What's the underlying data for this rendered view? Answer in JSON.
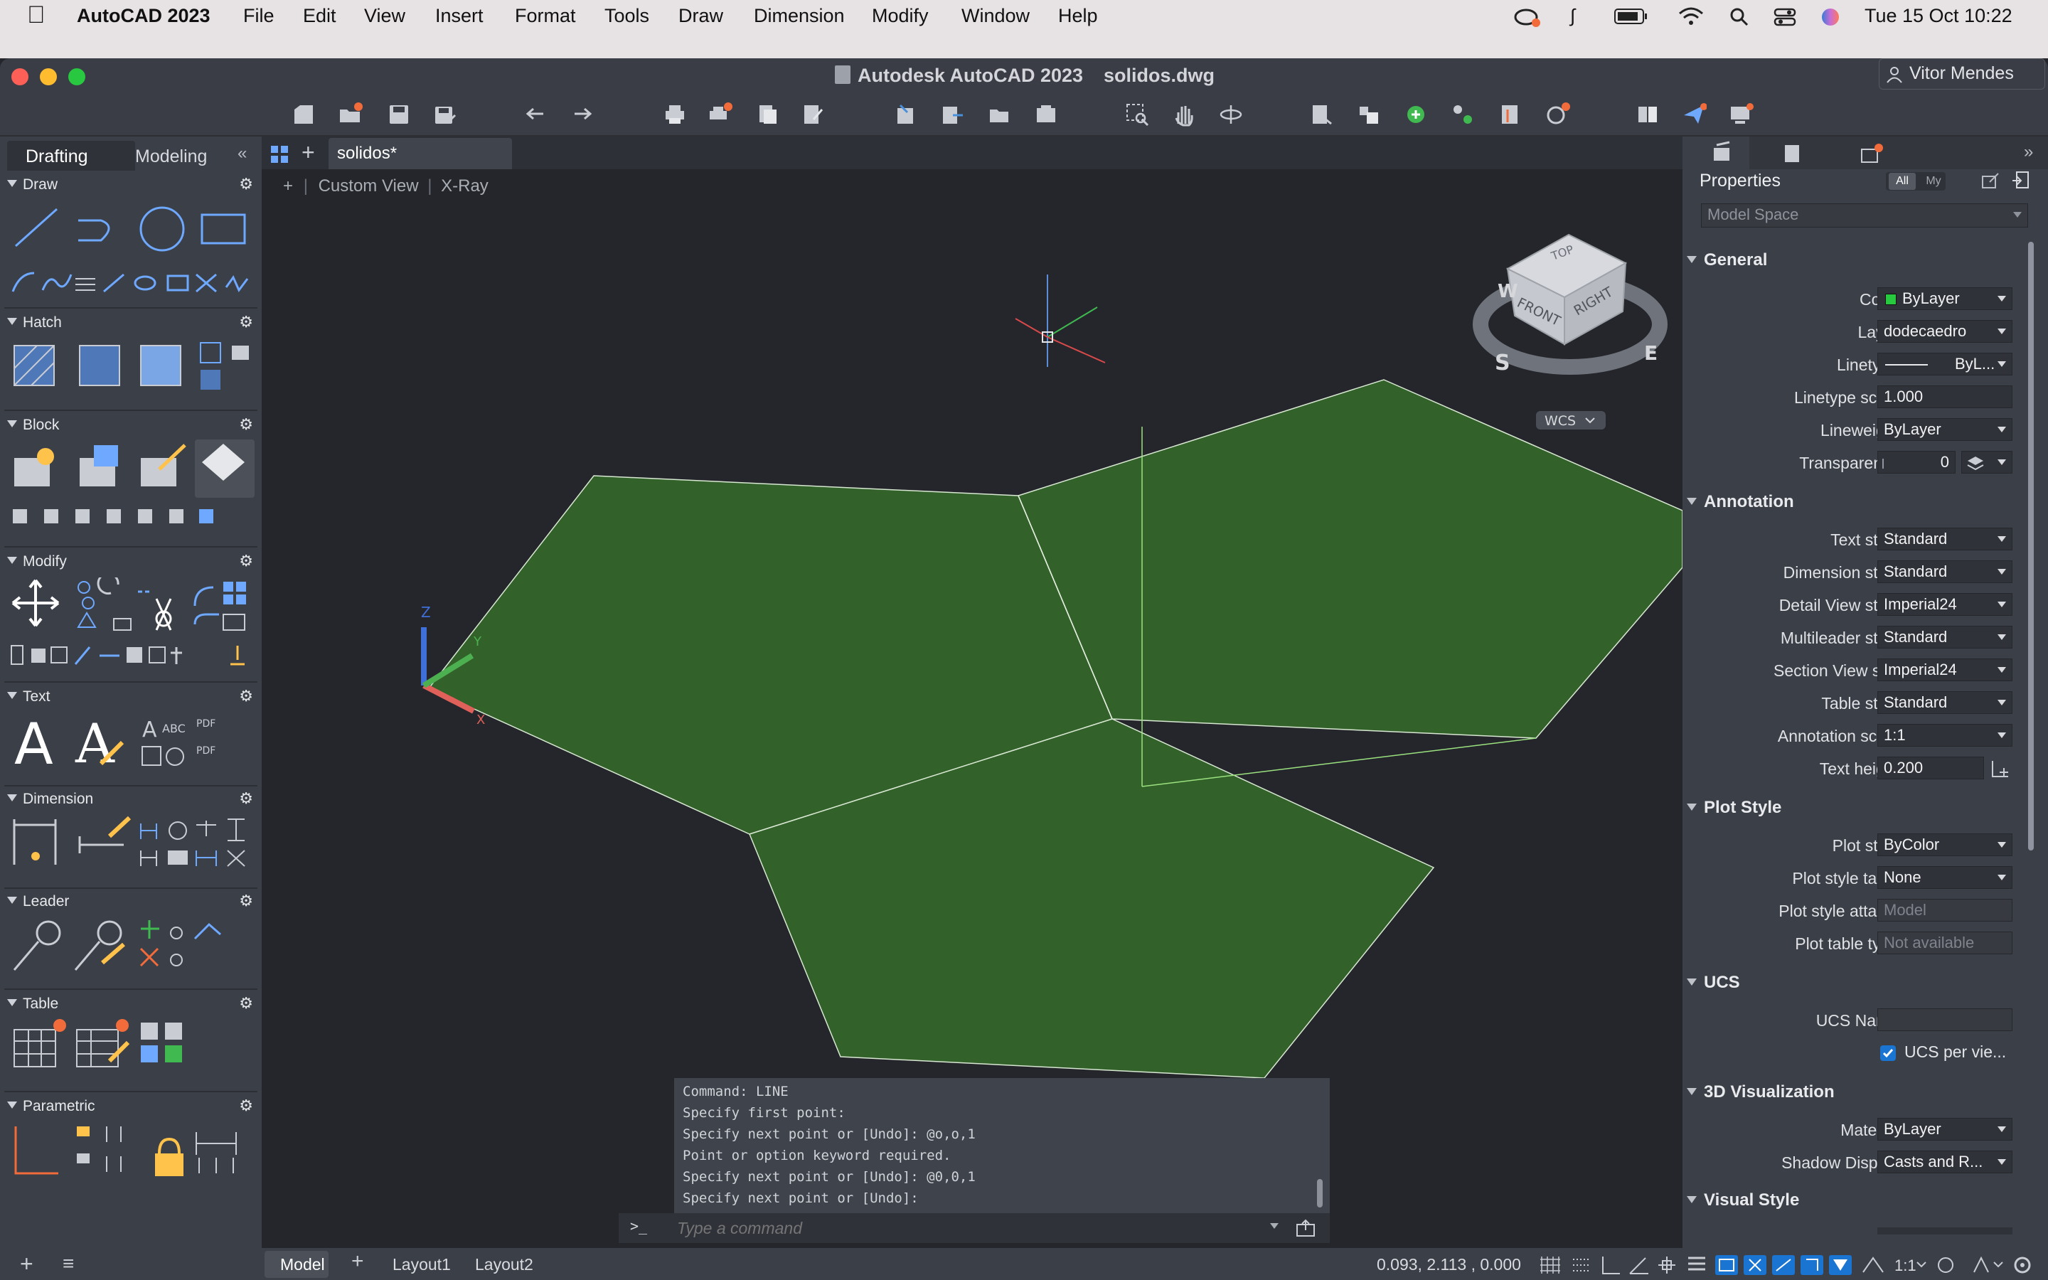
{
  "menubar": {
    "app_name": "AutoCAD 2023",
    "items": [
      "File",
      "Edit",
      "View",
      "Insert",
      "Format",
      "Tools",
      "Draw",
      "Dimension",
      "Modify",
      "Window",
      "Help"
    ],
    "datetime": "Tue 15 Oct  10:22"
  },
  "window": {
    "title_app": "Autodesk AutoCAD 2023",
    "title_file": "solidos.dwg",
    "user": "Vitor Mendes"
  },
  "palette": {
    "tabs": [
      "Drafting",
      "Modeling"
    ],
    "active_tab": "Drafting",
    "sections": [
      {
        "name": "Draw"
      },
      {
        "name": "Hatch"
      },
      {
        "name": "Block"
      },
      {
        "name": "Modify"
      },
      {
        "name": "Text"
      },
      {
        "name": "Dimension"
      },
      {
        "name": "Leader"
      },
      {
        "name": "Table"
      },
      {
        "name": "Parametric"
      }
    ]
  },
  "document": {
    "tab_label": "solidos*",
    "viewport_controls": [
      "+",
      "Custom View",
      "X-Ray"
    ]
  },
  "viewcube": {
    "faces": [
      "TOP",
      "FRONT",
      "RIGHT"
    ],
    "compass": [
      "W",
      "S",
      "E"
    ],
    "ucs_label": "WCS"
  },
  "axes": {
    "z": "Z",
    "y": "Y",
    "x": "X"
  },
  "command": {
    "history": [
      "Command: LINE",
      "Specify first point:",
      "Specify next point or [Undo]: @o,o,1",
      "Point or option keyword required.",
      "Specify next point or [Undo]: @0,0,1",
      "Specify next point or [Undo]:"
    ],
    "prompt_icon": ">_",
    "placeholder": "Type a command"
  },
  "properties": {
    "title": "Properties",
    "filter_all": "All",
    "filter_my": "My",
    "selection": "Model Space",
    "groups": {
      "general": "General",
      "annotation": "Annotation",
      "plot_style": "Plot Style",
      "ucs": "UCS",
      "visualization": "3D Visualization",
      "visual_style": "Visual Style"
    },
    "general": [
      {
        "label": "Color",
        "value": "ByLayer"
      },
      {
        "label": "Layer",
        "value": "dodecaedro"
      },
      {
        "label": "Linetype",
        "value": "ByL..."
      },
      {
        "label": "Linetype scale",
        "value": "1.000"
      },
      {
        "label": "Lineweight",
        "value": "ByLayer"
      },
      {
        "label": "Transparency",
        "value": "0"
      }
    ],
    "annotation": [
      {
        "label": "Text style",
        "value": "Standard"
      },
      {
        "label": "Dimension style",
        "value": "Standard"
      },
      {
        "label": "Detail View style",
        "value": "Imperial24"
      },
      {
        "label": "Multileader style",
        "value": "Standard"
      },
      {
        "label": "Section View st...",
        "value": "Imperial24"
      },
      {
        "label": "Table style",
        "value": "Standard"
      },
      {
        "label": "Annotation scale",
        "value": "1:1"
      },
      {
        "label": "Text height",
        "value": "0.200"
      }
    ],
    "plot": [
      {
        "label": "Plot style",
        "value": "ByColor"
      },
      {
        "label": "Plot style table",
        "value": "None"
      },
      {
        "label": "Plot style attac...",
        "value": "Model"
      },
      {
        "label": "Plot table type",
        "value": "Not available"
      }
    ],
    "ucs": [
      {
        "label": "UCS Name",
        "value": ""
      },
      {
        "label": "UCS per vie...",
        "value": ""
      }
    ],
    "visualization": [
      {
        "label": "Material",
        "value": "ByLayer"
      },
      {
        "label": "Shadow Display",
        "value": "Casts and R..."
      }
    ]
  },
  "status": {
    "tabs": [
      "Model",
      "Layout1",
      "Layout2"
    ],
    "active_tab": "Model",
    "coords": "0.093, 2.113 , 0.000",
    "scale": "1:1"
  },
  "colors": {
    "accent": "#1a74d2",
    "solid_fill": "#32612a",
    "badge": "#f26b3a",
    "layer_color": "#27c93f"
  }
}
